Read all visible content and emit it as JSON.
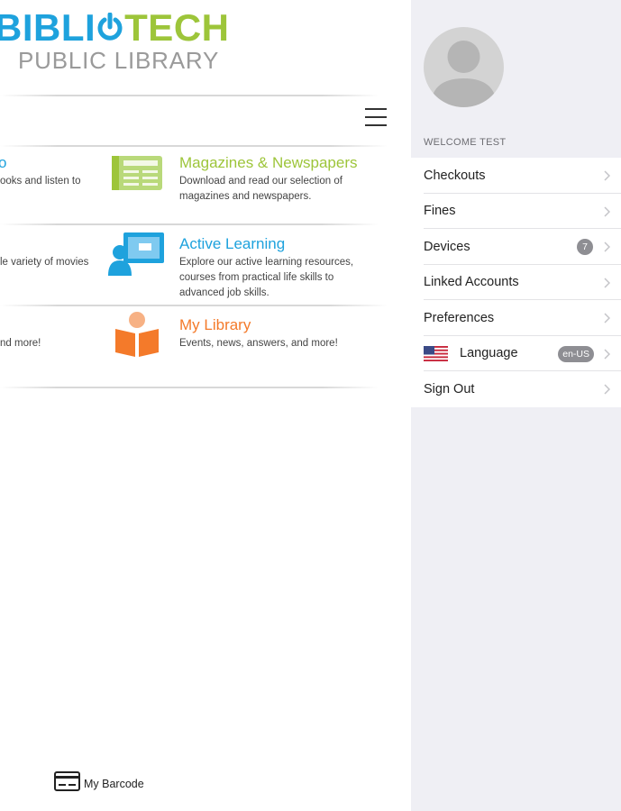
{
  "logo": {
    "part1": "BIBLI",
    "part2": "TECH",
    "subtitle": "PUBLIC LIBRARY",
    "colors": {
      "blue": "#1ea2dd",
      "green": "#9dc53a",
      "gray": "#9a9a9a"
    }
  },
  "header": {
    "menu_icon": "hamburger-menu-icon"
  },
  "tiles": [
    {
      "title": "o",
      "desc": [
        "ooks and listen to"
      ]
    },
    {
      "title": "Magazines & Newspapers",
      "desc": [
        "Download and read our selection of",
        "magazines and newspapers."
      ],
      "icon": "newspaper-icon",
      "color": "#9dc53a"
    },
    {
      "title": "",
      "desc": [
        "le variety of movies"
      ]
    },
    {
      "title": "Active Learning",
      "desc": [
        "Explore our active learning resources,",
        "courses from practical life skills to",
        "advanced job skills."
      ],
      "icon": "classroom-icon",
      "color": "#1ea2dd"
    },
    {
      "title": "",
      "desc": [
        "nd more!"
      ]
    },
    {
      "title": "My Library",
      "desc": [
        "Events, news, answers, and more!"
      ],
      "icon": "reader-book-icon",
      "color": "#f47a2a"
    }
  ],
  "footer": {
    "barcode_label": "My Barcode",
    "icon": "barcode-card-icon"
  },
  "sidebar": {
    "welcome": "WELCOME TEST",
    "menu": [
      {
        "label": "Checkouts"
      },
      {
        "label": "Fines"
      },
      {
        "label": "Devices",
        "badge": "7"
      },
      {
        "label": "Linked Accounts"
      },
      {
        "label": "Preferences"
      },
      {
        "label": "Language",
        "badge": "en-US",
        "icon": "us-flag-icon"
      },
      {
        "label": "Sign Out"
      }
    ]
  }
}
